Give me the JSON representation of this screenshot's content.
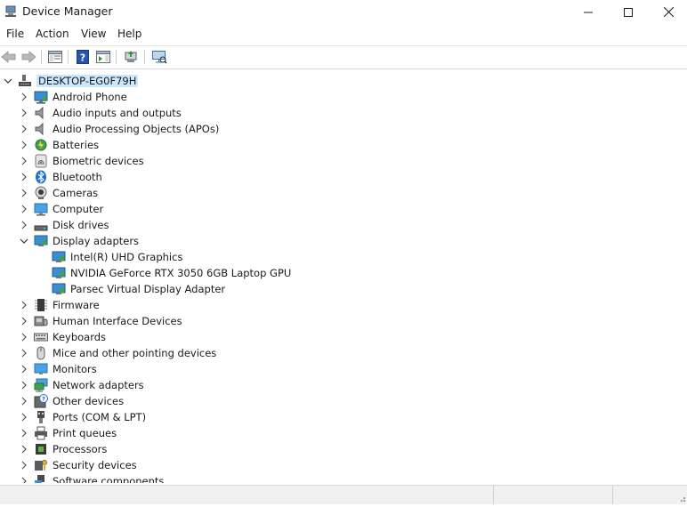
{
  "window": {
    "title": "Device Manager"
  },
  "menu": [
    {
      "label": "File"
    },
    {
      "label": "Action"
    },
    {
      "label": "View"
    },
    {
      "label": "Help"
    }
  ],
  "toolbar": [
    {
      "icon": "back-arrow-icon"
    },
    {
      "icon": "forward-arrow-icon"
    },
    {
      "icon": "show-hide-console-tree-icon"
    },
    {
      "icon": "help-icon"
    },
    {
      "icon": "action-pane-icon"
    },
    {
      "icon": "update-driver-icon"
    },
    {
      "icon": "scan-hardware-icon"
    }
  ],
  "tree": {
    "root": {
      "label": "DESKTOP-EG0F79H",
      "expanded": true,
      "selected": true
    },
    "categories": [
      {
        "label": "Android Phone",
        "icon": "android-phone-icon",
        "expanded": false
      },
      {
        "label": "Audio inputs and outputs",
        "icon": "speaker-icon",
        "expanded": false
      },
      {
        "label": "Audio Processing Objects (APOs)",
        "icon": "speaker-icon",
        "expanded": false
      },
      {
        "label": "Batteries",
        "icon": "battery-icon",
        "expanded": false
      },
      {
        "label": "Biometric devices",
        "icon": "fingerprint-icon",
        "expanded": false
      },
      {
        "label": "Bluetooth",
        "icon": "bluetooth-icon",
        "expanded": false
      },
      {
        "label": "Cameras",
        "icon": "camera-icon",
        "expanded": false
      },
      {
        "label": "Computer",
        "icon": "computer-icon",
        "expanded": false
      },
      {
        "label": "Disk drives",
        "icon": "disk-drive-icon",
        "expanded": false
      },
      {
        "label": "Display adapters",
        "icon": "display-adapter-icon",
        "expanded": true,
        "children": [
          {
            "label": "Intel(R) UHD Graphics",
            "icon": "display-adapter-icon"
          },
          {
            "label": "NVIDIA GeForce RTX 3050 6GB Laptop GPU",
            "icon": "display-adapter-icon"
          },
          {
            "label": "Parsec Virtual Display Adapter",
            "icon": "display-adapter-icon"
          }
        ]
      },
      {
        "label": "Firmware",
        "icon": "firmware-chip-icon",
        "expanded": false
      },
      {
        "label": "Human Interface Devices",
        "icon": "hid-icon",
        "expanded": false
      },
      {
        "label": "Keyboards",
        "icon": "keyboard-icon",
        "expanded": false
      },
      {
        "label": "Mice and other pointing devices",
        "icon": "mouse-icon",
        "expanded": false
      },
      {
        "label": "Monitors",
        "icon": "monitor-icon",
        "expanded": false
      },
      {
        "label": "Network adapters",
        "icon": "network-adapter-icon",
        "expanded": false
      },
      {
        "label": "Other devices",
        "icon": "unknown-device-icon",
        "expanded": false
      },
      {
        "label": "Ports (COM & LPT)",
        "icon": "port-icon",
        "expanded": false
      },
      {
        "label": "Print queues",
        "icon": "printer-icon",
        "expanded": false
      },
      {
        "label": "Processors",
        "icon": "processor-icon",
        "expanded": false
      },
      {
        "label": "Security devices",
        "icon": "security-key-icon",
        "expanded": false
      },
      {
        "label": "Software components",
        "icon": "software-component-icon",
        "expanded": false
      }
    ]
  },
  "colors": {
    "selection": "#cce8ff",
    "accent": "#0078d4",
    "statusbar": "#f0f0f0"
  }
}
